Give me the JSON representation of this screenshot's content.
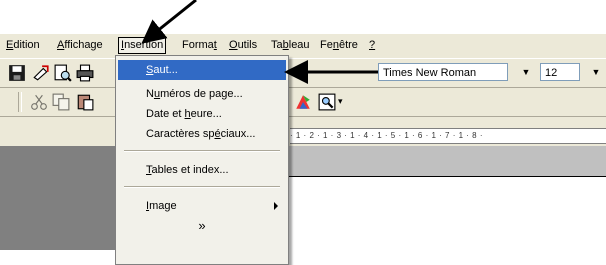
{
  "menubar": {
    "items": [
      {
        "label": "Edition"
      },
      {
        "label": "Affichage"
      },
      {
        "label": "Insertion"
      },
      {
        "label": "Format"
      },
      {
        "label": "Outils"
      },
      {
        "label": "Tableau"
      },
      {
        "label": "Fenêtre"
      },
      {
        "label": "?"
      }
    ]
  },
  "toolbar": {
    "font_name": "Times New Roman",
    "font_size": "12"
  },
  "ruler": {
    "marks": "· 1 · 2 · 1 · 3 · 1 · 4 · 1 · 5 · 1 · 6 · 1 · 7 · 1 · 8 ·"
  },
  "insertion_menu": {
    "items": [
      {
        "label": "Saut..."
      },
      {
        "label": "Numéros de page..."
      },
      {
        "label": "Date et heure..."
      },
      {
        "label": "Caractères spéciaux..."
      },
      {
        "label": "Tables et index..."
      },
      {
        "label": "Image"
      },
      {
        "label": "»"
      }
    ]
  },
  "colors": {
    "menu_highlight": "#316ac5",
    "chrome": "#ece9d8"
  }
}
